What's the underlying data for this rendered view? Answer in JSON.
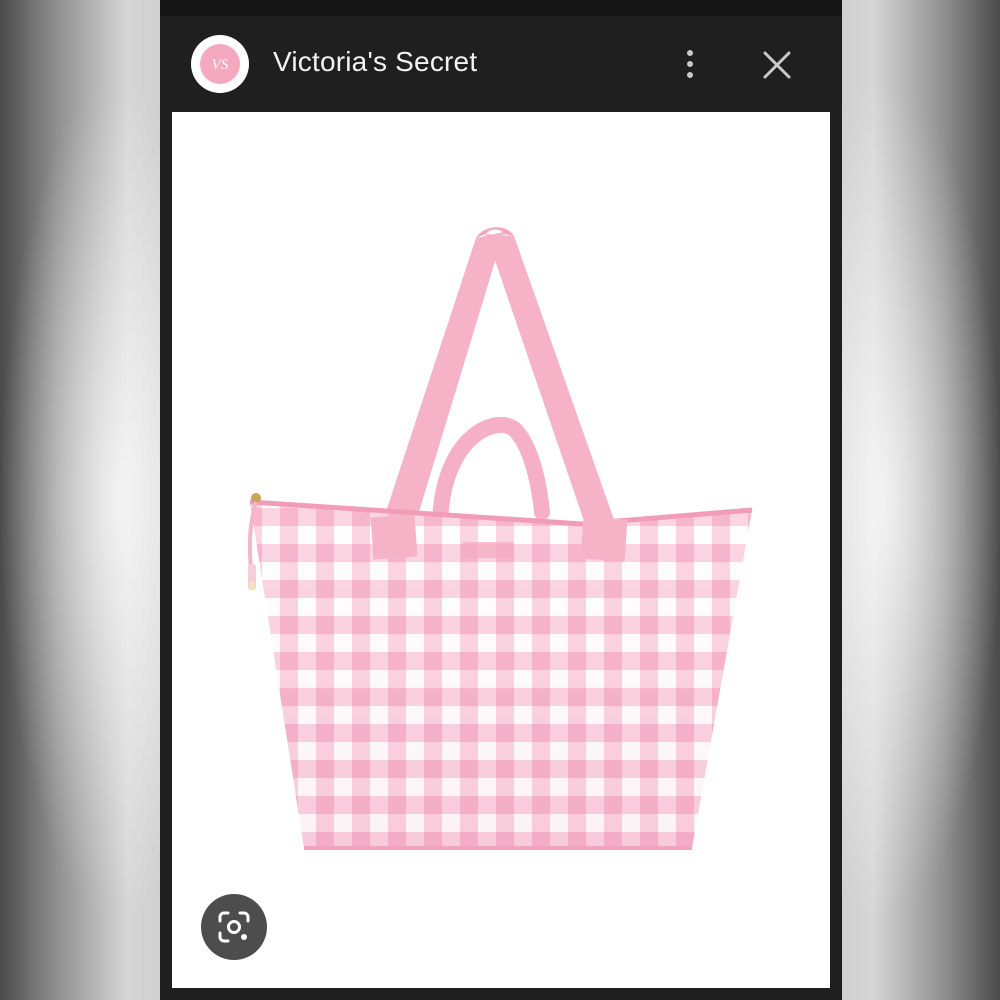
{
  "app": {
    "title": "Victoria's Secret",
    "logo_text": "VS"
  },
  "header": {
    "avatar_icon": "vs-logo-icon",
    "more_icon": "more-vertical-icon",
    "close_icon": "close-icon"
  },
  "content": {
    "image_subject": "product-image",
    "lens_icon": "google-lens-icon"
  },
  "colors": {
    "bar_bg": "#1f1f1f",
    "brand_pink": "#f4a9be",
    "strap_pink": "#f6b3c8",
    "gingham_pink": "#f8bdd2",
    "lens_bg": "#4d4d4d"
  }
}
